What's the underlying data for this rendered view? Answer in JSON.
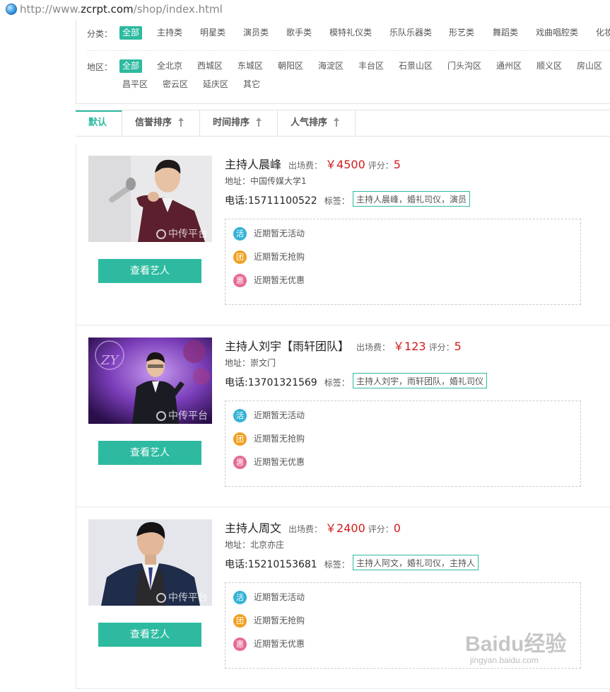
{
  "browser": {
    "url_prefix": "http://www.",
    "url_domain": "zcrpt.com",
    "url_path": "/shop/index.html"
  },
  "filters": {
    "category_label": "分类：",
    "categories": [
      "全部",
      "主持类",
      "明星类",
      "演员类",
      "歌手类",
      "模特礼仪类",
      "乐队乐器类",
      "形艺类",
      "舞蹈类",
      "戏曲唱腔类",
      "化妆"
    ],
    "region_label": "地区：",
    "regions_row1": [
      "全部",
      "全北京",
      "西城区",
      "东城区",
      "朝阳区",
      "海淀区",
      "丰台区",
      "石景山区",
      "门头沟区",
      "通州区",
      "顺义区",
      "房山区"
    ],
    "regions_row2": [
      "昌平区",
      "密云区",
      "延庆区",
      "其它"
    ]
  },
  "sort_tabs": [
    "默认",
    "信誉排序",
    "时间排序",
    "人气排序"
  ],
  "labels": {
    "fee": "出场费：",
    "score": "评分：",
    "address": "地址：",
    "phone": "电话:",
    "tags": "标签：",
    "view_button": "查看艺人",
    "no_activity": "近期暂无活动",
    "no_groupbuy": "近期暂无抢购",
    "no_discount": "近期暂无优惠",
    "icon_activity": "活",
    "icon_groupbuy": "团",
    "icon_discount": "惠",
    "watermark": "中传平台"
  },
  "artists": [
    {
      "name": "主持人晨峰",
      "price": "￥4500",
      "score": "5",
      "address": "中国传媒大学1",
      "phone": "15711100522",
      "tags": "主持人晨峰，婚礼司仪，演员"
    },
    {
      "name": "主持人刘宇【雨轩团队】",
      "price": "￥123",
      "score": "5",
      "address": "崇文门",
      "phone": "13701321569",
      "tags": "主持人刘宇，雨轩团队，婚礼司仪"
    },
    {
      "name": "主持人周文",
      "price": "￥2400",
      "score": "0",
      "address": "北京亦庄",
      "phone": "15210153681",
      "tags": "主持人阿文，婚礼司仪，主持人"
    }
  ],
  "watermark": {
    "brand": "Baidu经验",
    "sub": "jingyan.baidu.com"
  }
}
